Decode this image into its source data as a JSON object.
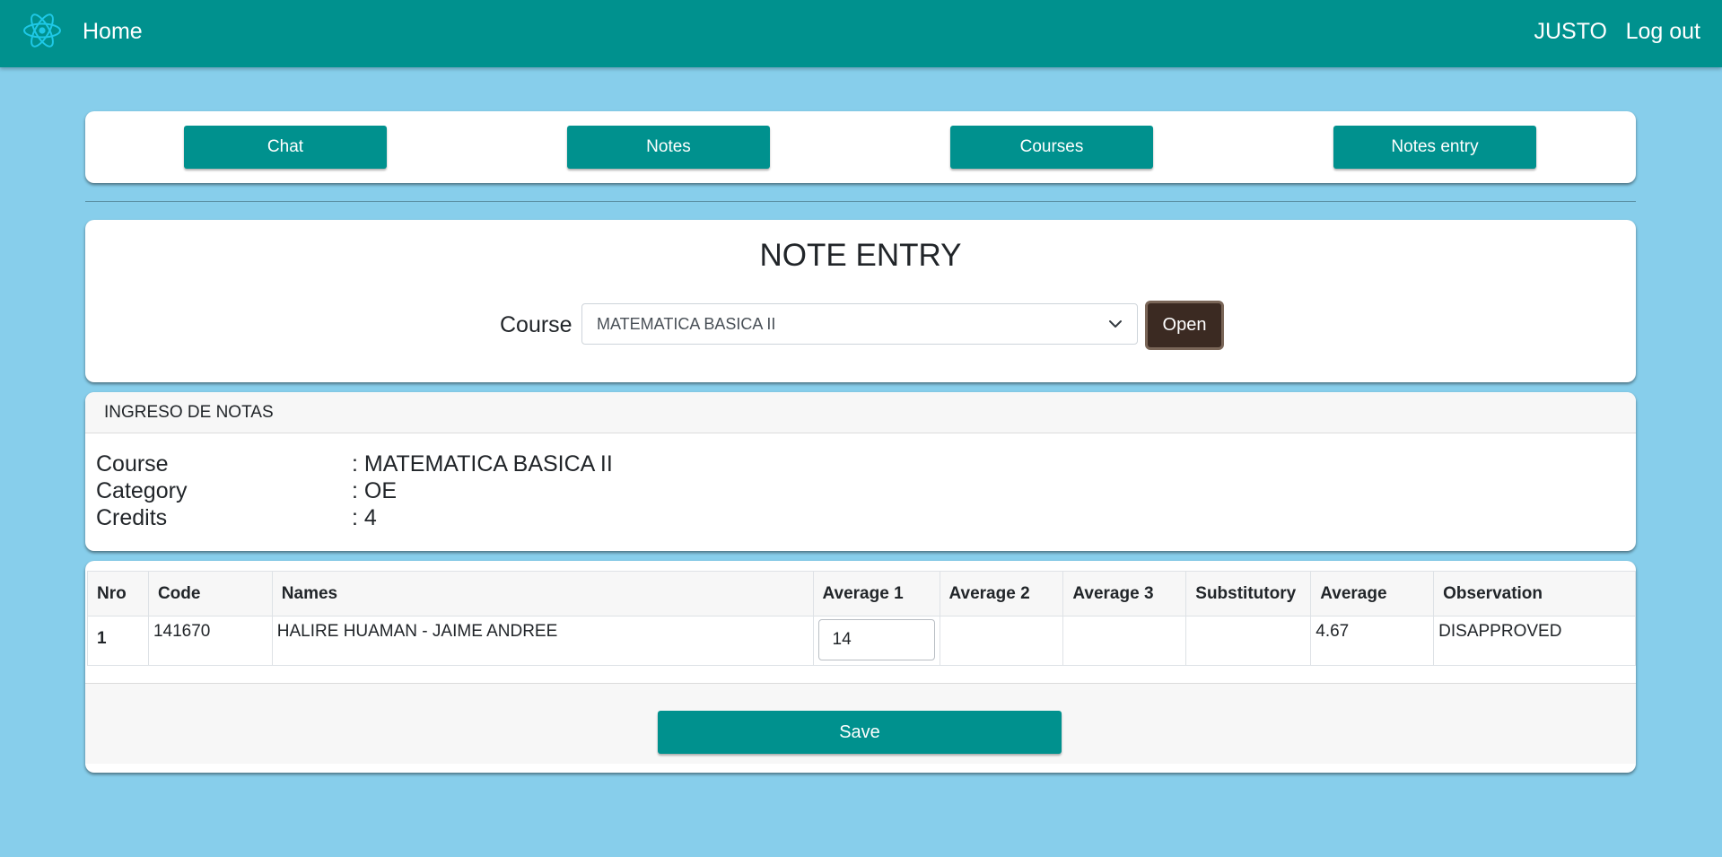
{
  "navbar": {
    "logo_icon": "react-atom-icon",
    "home_label": "Home",
    "user_name": "JUSTO",
    "logout_label": "Log out"
  },
  "menu": {
    "buttons": [
      {
        "label": "Chat"
      },
      {
        "label": "Notes"
      },
      {
        "label": "Courses"
      },
      {
        "label": "Notes entry"
      }
    ]
  },
  "entry": {
    "title": "NOTE ENTRY",
    "course_label": "Course",
    "course_selected": "MATEMATICA BASICA II",
    "open_label": "Open"
  },
  "info": {
    "header": "INGRESO DE NOTAS",
    "rows": [
      {
        "key": "Course",
        "value": ": MATEMATICA BASICA II"
      },
      {
        "key": "Category",
        "value": ": OE"
      },
      {
        "key": "Credits",
        "value": ": 4"
      }
    ]
  },
  "table": {
    "headers": [
      "Nro",
      "Code",
      "Names",
      "Average 1",
      "Average 2",
      "Average 3",
      "Substitutory",
      "Average",
      "Observation"
    ],
    "rows": [
      {
        "nro": "1",
        "code": "141670",
        "names": "HALIRE HUAMAN - JAIME ANDREE",
        "average1": "14",
        "average2": "",
        "average3": "",
        "substitutory": "",
        "average": "4.67",
        "observation": "DISAPPROVED"
      }
    ],
    "save_label": "Save"
  },
  "colors": {
    "background": "#87ceeb",
    "primary": "#00918e",
    "open_button": "#3b2a22",
    "atom_icon": "#1ec8e6"
  }
}
